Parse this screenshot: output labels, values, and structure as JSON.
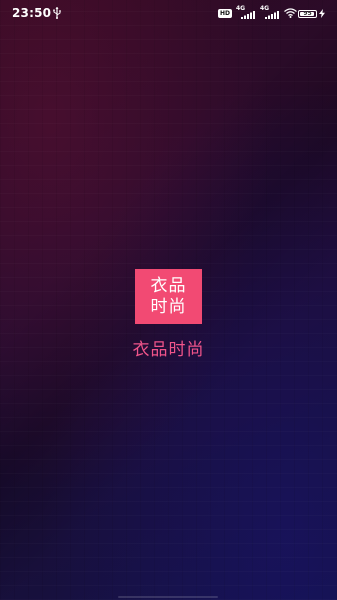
{
  "status_bar": {
    "time": "23:50",
    "hd_badge": "HD",
    "signal_1_label": "4G",
    "signal_2_label": "4G",
    "battery_level": "95",
    "battery_fraction": 0.95
  },
  "splash": {
    "logo_line_1": "衣品",
    "logo_line_2": "时尚",
    "app_name": "衣品时尚"
  },
  "colors": {
    "accent": "#f24a73",
    "app_name_text": "#f0548a",
    "status_text": "#ffffff"
  },
  "icons": {
    "usb": "usb-icon",
    "wifi": "wifi-icon",
    "charge": "charging-bolt-icon"
  }
}
